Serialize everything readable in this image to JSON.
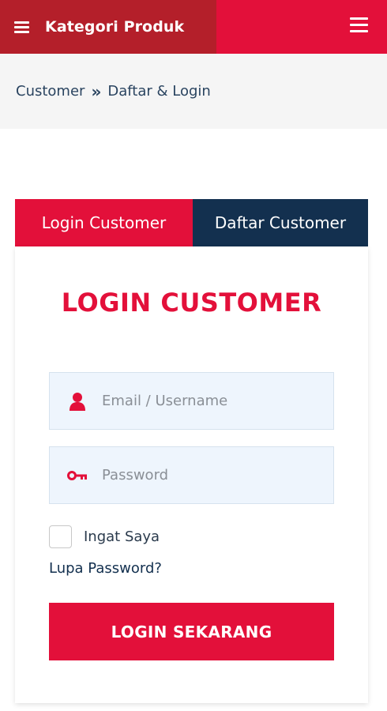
{
  "header": {
    "category_label": "Kategori Produk",
    "category_menu_icon": "hamburger-menu-icon",
    "main_menu_icon": "hamburger-menu-icon"
  },
  "breadcrumb": {
    "items": [
      "Customer",
      "Daftar & Login"
    ],
    "separator": "»"
  },
  "tabs": [
    {
      "label": "Login Customer",
      "active": true
    },
    {
      "label": "Daftar Customer",
      "active": false
    }
  ],
  "login_form": {
    "title": "LOGIN CUSTOMER",
    "email_placeholder": "Email / Username",
    "email_icon": "user-icon",
    "password_placeholder": "Password",
    "password_icon": "key-icon",
    "remember_label": "Ingat Saya",
    "remember_checked": false,
    "forgot_label": "Lupa Password?",
    "submit_label": "LOGIN SEKARANG"
  },
  "colors": {
    "primary_red": "#e3103a",
    "dark_red": "#b41f2a",
    "navy": "#13304f"
  }
}
